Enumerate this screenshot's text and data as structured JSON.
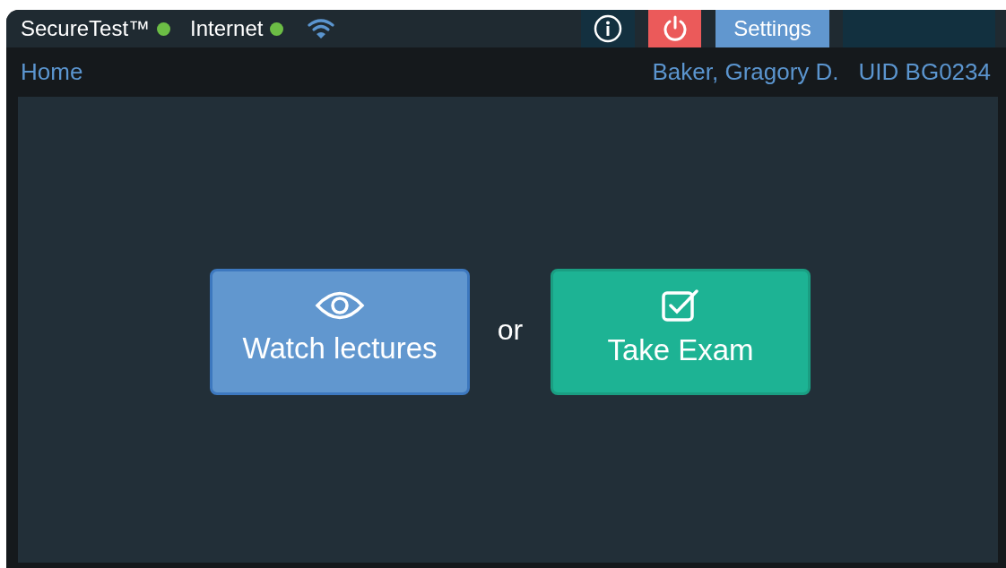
{
  "top_bar": {
    "app_name": "SecureTest™",
    "app_online": true,
    "network_label": "Internet",
    "network_online": true,
    "settings_button": "Settings"
  },
  "nav_bar": {
    "home_link": "Home",
    "user_name": "Baker, Gragory D.",
    "user_id": "UID BG0234"
  },
  "actions": [
    {
      "kind": "watch",
      "label": "Watch lectures"
    },
    {
      "kind": "exam",
      "label": "Take Exam"
    }
  ],
  "separator": "or"
}
